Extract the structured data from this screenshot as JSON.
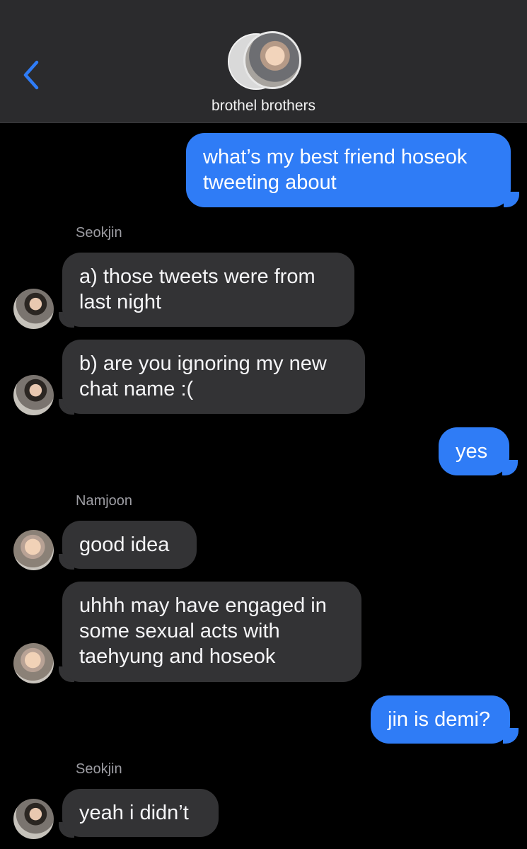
{
  "header": {
    "title": "brothel brothers",
    "back_icon": "chevron-left-icon",
    "accent_color": "#2f7cf6"
  },
  "messages": [
    {
      "type": "outgoing",
      "text_lines": [
        "what’s my best friend hoseok",
        "tweeting about"
      ]
    },
    {
      "type": "sender_name",
      "text": "Seokjin"
    },
    {
      "type": "incoming",
      "text_lines": [
        "a) those tweets were from",
        "last night"
      ]
    },
    {
      "type": "incoming",
      "text_lines": [
        "b) are you ignoring my new",
        "chat name :("
      ]
    },
    {
      "type": "outgoing",
      "text_lines": [
        "yes"
      ]
    },
    {
      "type": "sender_name",
      "text": "Namjoon"
    },
    {
      "type": "incoming",
      "text_lines": [
        "good idea"
      ]
    },
    {
      "type": "incoming",
      "text_lines": [
        "uhhh may have engaged in",
        "some sexual acts with",
        "taehyung and hoseok"
      ]
    },
    {
      "type": "outgoing",
      "text_lines": [
        "jin is demi?"
      ]
    },
    {
      "type": "sender_name",
      "text": "Seokjin"
    },
    {
      "type": "incoming",
      "text_lines": [
        "yeah i didn’t"
      ]
    }
  ],
  "colors": {
    "background": "#000000",
    "incoming_bubble": "#333335",
    "outgoing_bubble": "#2f7cf6",
    "header_bg": "#2b2b2d"
  }
}
